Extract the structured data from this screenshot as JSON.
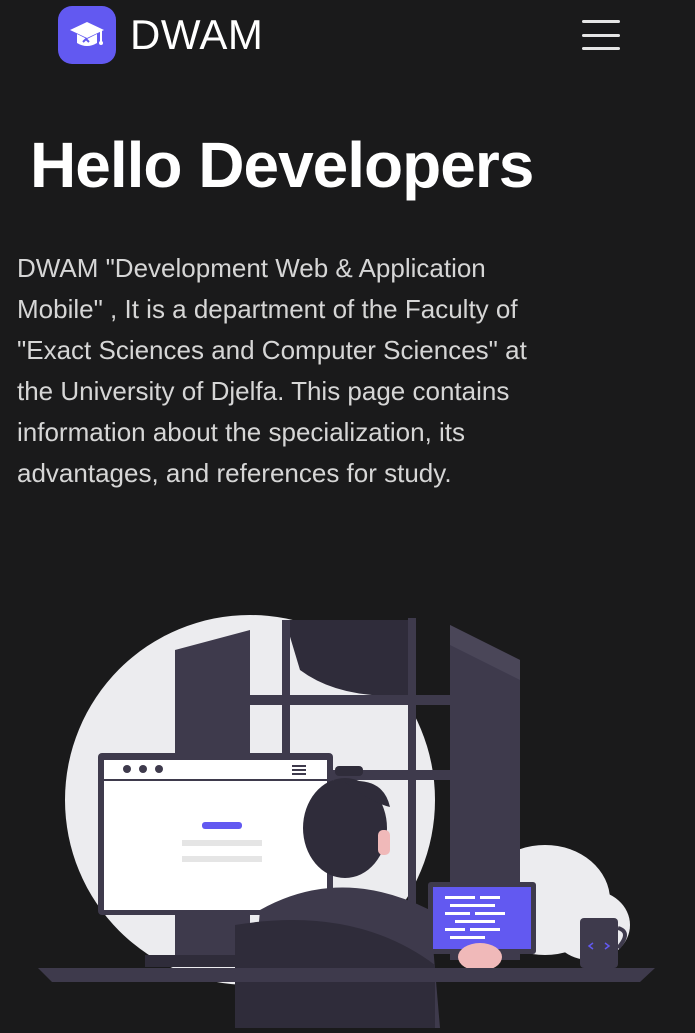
{
  "navbar": {
    "brand": "DWAM",
    "logo_icon": "graduation-cap-icon",
    "menu_icon": "hamburger-menu-icon"
  },
  "hero": {
    "title": "Hello Developers",
    "description": "DWAM \"Development Web & Application Mobile\" , It is a department of the Faculty of \"Exact Sciences and Computer Sciences\" at the University of Djelfa. This page contains information about the specialization, its advantages, and references for study."
  },
  "illustration": {
    "subject": "developer-at-desk-illustration"
  },
  "colors": {
    "background": "#1a1a1b",
    "accent": "#6259f1",
    "text_primary": "#ffffff",
    "text_secondary": "#d6d6d6"
  }
}
